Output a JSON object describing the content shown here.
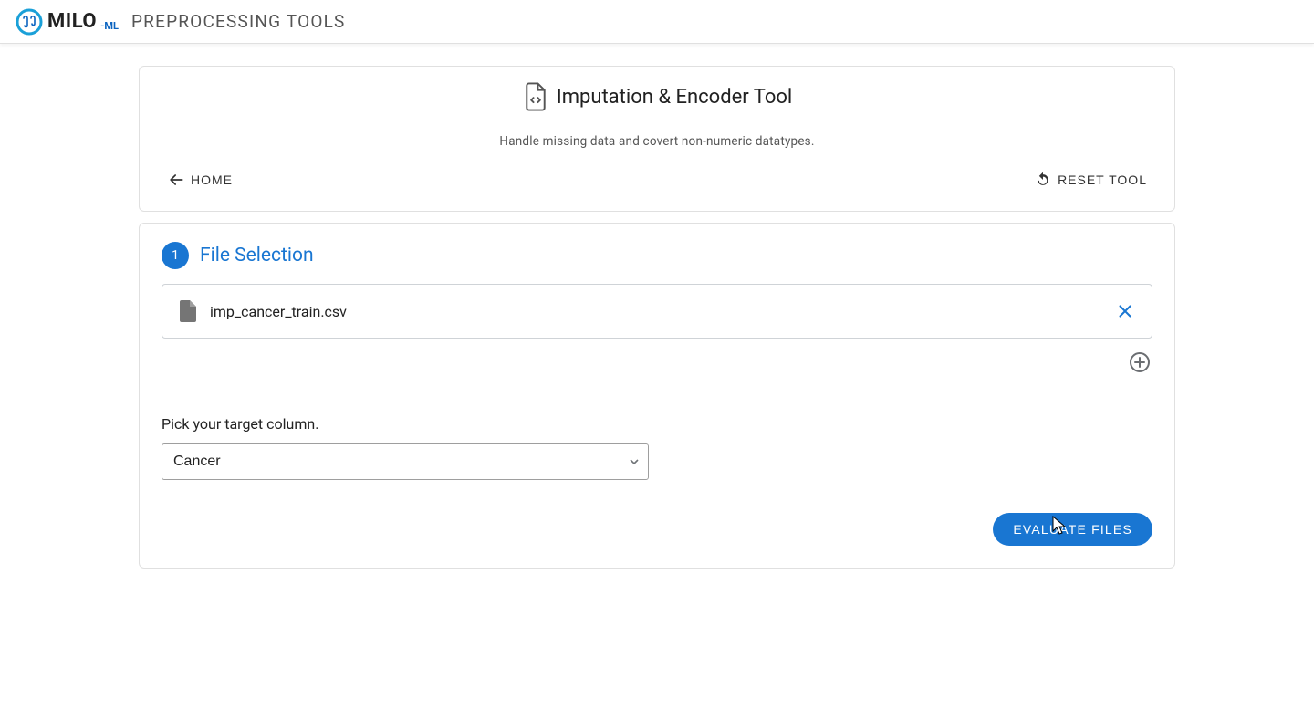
{
  "appbar": {
    "brand_main": "MILO",
    "brand_suffix": "-ML",
    "title": "PREPROCESSING TOOLS"
  },
  "tool": {
    "title": "Imputation & Encoder Tool",
    "subtitle": "Handle missing data and covert non-numeric datatypes.",
    "home_label": "HOME",
    "reset_label": "RESET TOOL"
  },
  "step": {
    "number": "1",
    "title": "File Selection",
    "files": [
      {
        "name": "imp_cancer_train.csv"
      }
    ],
    "target": {
      "label": "Pick your target column.",
      "value": "Cancer"
    },
    "evaluate_label": "EVALUATE FILES"
  },
  "colors": {
    "primary": "#1976d2"
  }
}
